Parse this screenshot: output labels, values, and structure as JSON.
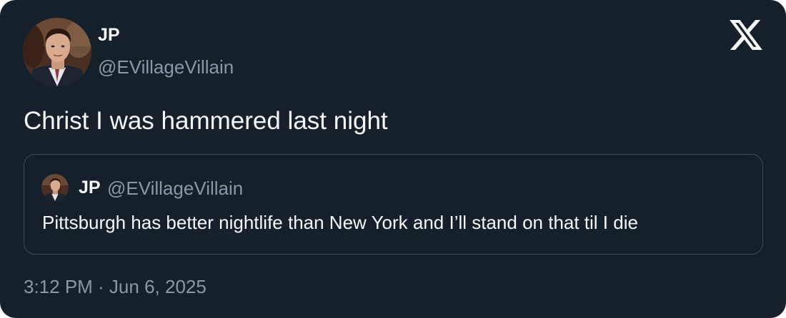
{
  "colors": {
    "background": "#15202b",
    "text_primary": "#f7f9f9",
    "text_secondary": "#8b98a5",
    "quote_border": "#3e4a56"
  },
  "tweet": {
    "author_name": "JP",
    "author_handle": "@EVillageVillain",
    "avatar_icon": "profile-photo",
    "text": "Christ I was hammered last night",
    "timestamp": "3:12 PM · Jun 6, 2025",
    "logo_icon": "x-logo-icon"
  },
  "quoted_tweet": {
    "author_name": "JP",
    "author_handle": "@EVillageVillain",
    "avatar_icon": "profile-photo",
    "text": "Pittsburgh has better nightlife than New York and I’ll stand on that til I die"
  }
}
